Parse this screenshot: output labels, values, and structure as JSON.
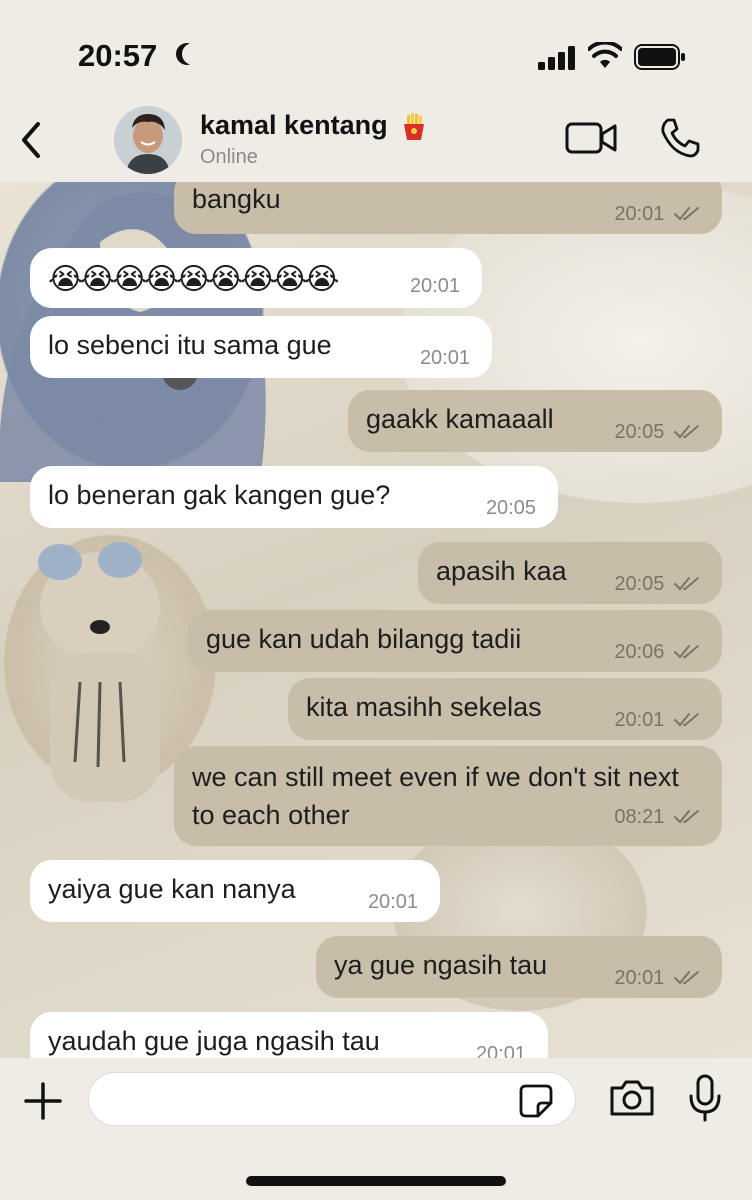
{
  "status_bar": {
    "time": "20:57",
    "moon_icon": "moon-icon",
    "signal_icon": "cellular-signal-icon",
    "wifi_icon": "wifi-icon",
    "battery_icon": "battery-icon"
  },
  "header": {
    "contact_name": "kamal kentang",
    "name_emoji_icon": "french-fries-icon",
    "status": "Online",
    "back_icon": "chevron-left-icon",
    "video_icon": "video-call-icon",
    "phone_icon": "phone-call-icon"
  },
  "messages": [
    {
      "direction": "out",
      "text": "bangku",
      "time": "20:01",
      "read": true
    },
    {
      "direction": "in",
      "text": "😭😭😭😭😭😭😭😭😭",
      "time": "20:01"
    },
    {
      "direction": "in",
      "text": "lo sebenci itu sama gue",
      "time": "20:01"
    },
    {
      "direction": "out",
      "text": "gaakk kamaaall",
      "time": "20:05",
      "read": true
    },
    {
      "direction": "in",
      "text": "lo beneran gak kangen gue?",
      "time": "20:05"
    },
    {
      "direction": "out",
      "text": "apasih kaa",
      "time": "20:05",
      "read": true
    },
    {
      "direction": "out",
      "text": "gue kan udah bilangg tadii",
      "time": "20:06",
      "read": true
    },
    {
      "direction": "out",
      "text": "kita masihh sekelas",
      "time": "20:01",
      "read": true
    },
    {
      "direction": "out",
      "text": "we can still meet even if we don't sit next to each other",
      "time": "08:21",
      "read": true
    },
    {
      "direction": "in",
      "text": "yaiya gue kan nanya",
      "time": "20:01"
    },
    {
      "direction": "out",
      "text": "ya gue ngasih tau",
      "time": "20:01",
      "read": true
    },
    {
      "direction": "in",
      "text": "yaudah gue juga ngasih tau",
      "time": "20:01"
    }
  ],
  "composer": {
    "input_value": "",
    "placeholder": "",
    "plus_icon": "plus-icon",
    "sticker_icon": "sticker-icon",
    "camera_icon": "camera-icon",
    "mic_icon": "microphone-icon"
  },
  "colors": {
    "incoming_bubble": "#ffffff",
    "outgoing_bubble": "#c7bda8",
    "bar_background": "#efece6"
  }
}
